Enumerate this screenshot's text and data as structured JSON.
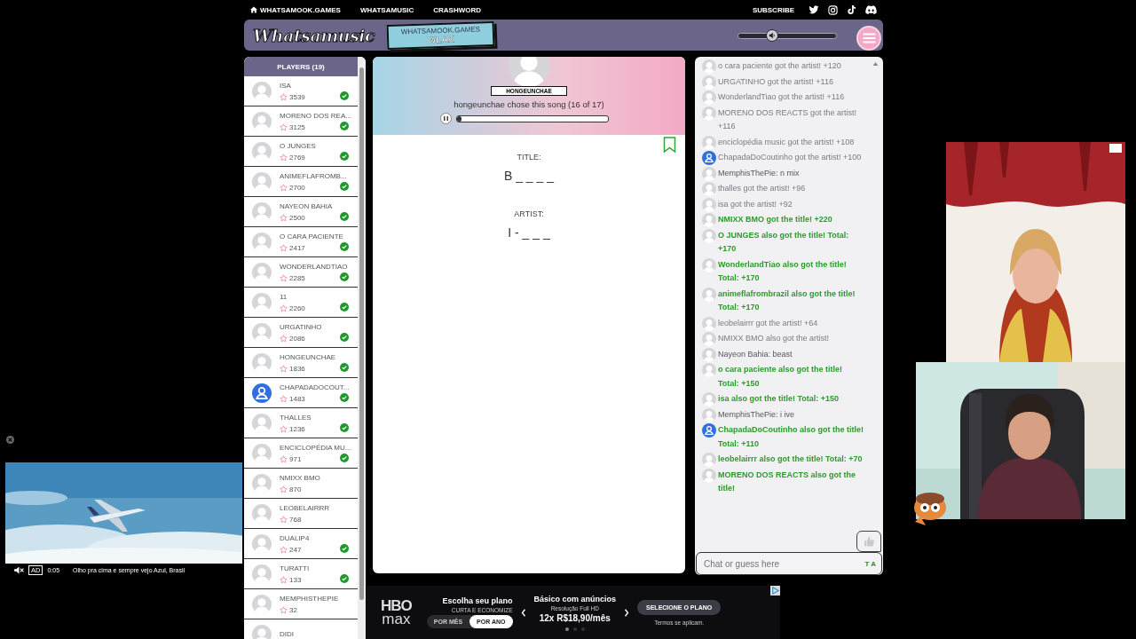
{
  "nav": {
    "links": [
      {
        "label": "WHATSAMOOK.GAMES",
        "kind": "home"
      },
      {
        "label": "WHATSAMUSIC",
        "kind": "plain"
      },
      {
        "label": "CRASHWORD",
        "kind": "plain"
      }
    ],
    "subscribe": "SUBSCRIBE"
  },
  "header": {
    "logo": "Whatsamusic",
    "tag_site": "WHATSAMOOK.GAMES",
    "tag_code": "WLAK",
    "volume": {
      "level": 0.35
    }
  },
  "players": {
    "title": "PLAYERS (19)",
    "items": [
      {
        "name": "ISA",
        "score": "3539",
        "guessed": true,
        "custom_avatar": false
      },
      {
        "name": "MORENO DOS REA...",
        "score": "3125",
        "guessed": true,
        "custom_avatar": false
      },
      {
        "name": "O JUNGES",
        "score": "2769",
        "guessed": true,
        "custom_avatar": false
      },
      {
        "name": "ANIMEFLAFROMB...",
        "score": "2700",
        "guessed": true,
        "custom_avatar": false
      },
      {
        "name": "NAYEON BAHIA",
        "score": "2500",
        "guessed": true,
        "custom_avatar": false
      },
      {
        "name": "O CARA PACIENTE",
        "score": "2417",
        "guessed": true,
        "custom_avatar": false
      },
      {
        "name": "WONDERLANDTIAO",
        "score": "2285",
        "guessed": true,
        "custom_avatar": false
      },
      {
        "name": "11",
        "score": "2260",
        "guessed": true,
        "custom_avatar": false
      },
      {
        "name": "URGATINHO",
        "score": "2086",
        "guessed": true,
        "custom_avatar": false
      },
      {
        "name": "HONGEUNCHAE",
        "score": "1836",
        "guessed": true,
        "custom_avatar": false
      },
      {
        "name": "CHAPADADOCOUT...",
        "score": "1483",
        "guessed": true,
        "custom_avatar": true
      },
      {
        "name": "THALLES",
        "score": "1236",
        "guessed": true,
        "custom_avatar": false
      },
      {
        "name": "ENCICLOPÉDIA MU...",
        "score": "971",
        "guessed": true,
        "custom_avatar": false
      },
      {
        "name": "NMIXX BMO",
        "score": "870",
        "guessed": false,
        "custom_avatar": false
      },
      {
        "name": "LEOBELAIRRR",
        "score": "768",
        "guessed": false,
        "custom_avatar": false
      },
      {
        "name": "DUALIP4",
        "score": "247",
        "guessed": true,
        "custom_avatar": false
      },
      {
        "name": "TURATTI",
        "score": "133",
        "guessed": true,
        "custom_avatar": false
      },
      {
        "name": "MEMPHISTHEPIE",
        "score": "32",
        "guessed": false,
        "custom_avatar": false
      },
      {
        "name": "DIDI",
        "guessed": false,
        "custom_avatar": false
      }
    ]
  },
  "song": {
    "chooser": "HONGEUNCHAE",
    "caption": "hongeunchae chose this song (16 of 17)",
    "playing": true,
    "progress": {
      "level": 0.03
    },
    "title_label": "TITLE:",
    "title_hint": "B _ _ _ _",
    "artist_label": "ARTIST:",
    "artist_hint": "I - _ _ _"
  },
  "chat": {
    "messages": [
      {
        "text": "o cara paciente got the artist! +120",
        "kind": "artist",
        "custom_avatar": false
      },
      {
        "text": "URGATINHO got the artist! +116",
        "kind": "artist",
        "custom_avatar": false
      },
      {
        "text": "WonderlandTiao got the artist! +116",
        "kind": "artist",
        "custom_avatar": false
      },
      {
        "text": "MORENO DOS REACTS got the artist! +116",
        "kind": "artist",
        "custom_avatar": false
      },
      {
        "text": "enciclopédia music got the artist! +108",
        "kind": "artist",
        "custom_avatar": false
      },
      {
        "text": "ChapadaDoCoutinho got the artist! +100",
        "kind": "artist",
        "custom_avatar": true
      },
      {
        "text": "MemphisThePie: n mix",
        "kind": "chat",
        "custom_avatar": false
      },
      {
        "text": "thalles got the artist! +96",
        "kind": "artist",
        "custom_avatar": false
      },
      {
        "text": "isa got the artist! +92",
        "kind": "artist",
        "custom_avatar": false
      },
      {
        "text": "NMIXX BMO got the title! +220",
        "kind": "title",
        "custom_avatar": false
      },
      {
        "text": "O JUNGES also got the title! Total: +170",
        "kind": "title",
        "custom_avatar": false
      },
      {
        "text": "WonderlandTiao also got the title! Total: +170",
        "kind": "title",
        "custom_avatar": false
      },
      {
        "text": "animeflafrombrazil also got the title! Total: +170",
        "kind": "title",
        "custom_avatar": false
      },
      {
        "text": "leobelairrr got the artist! +64",
        "kind": "artist",
        "custom_avatar": false
      },
      {
        "text": "NMIXX BMO also got the artist!",
        "kind": "artist",
        "custom_avatar": false
      },
      {
        "text": "Nayeon Bahia: beast",
        "kind": "chat",
        "custom_avatar": false
      },
      {
        "text": "o cara paciente also got the title! Total: +150",
        "kind": "title",
        "custom_avatar": false
      },
      {
        "text": "isa also got the title! Total: +150",
        "kind": "title",
        "custom_avatar": false
      },
      {
        "text": "MemphisThePie: i ive",
        "kind": "chat",
        "custom_avatar": false
      },
      {
        "text": "ChapadaDoCoutinho also got the title! Total: +110",
        "kind": "title",
        "custom_avatar": true
      },
      {
        "text": "leobelairrr also got the title! Total: +70",
        "kind": "title",
        "custom_avatar": false
      },
      {
        "text": "MORENO DOS REACTS also got the title!",
        "kind": "title",
        "custom_avatar": false
      }
    ],
    "input": {
      "placeholder": "Chat or guess here",
      "tools": "T A"
    }
  },
  "video_ad": {
    "label": "AD",
    "time": "0:05",
    "caption": "Olho pra cima e sempre vejo Azul, Brasil",
    "muted": true
  },
  "bottom_ad": {
    "logo_top": "HBO",
    "logo_bottom": "max",
    "heading": "Escolha seu plano",
    "subheading": "CURTA E ECONOMIZE",
    "options": [
      {
        "label": "POR MÊS",
        "selected": false
      },
      {
        "label": "POR ANO",
        "selected": true
      }
    ],
    "plan": "Básico com anúncios",
    "plan_note": "Resolução Full HD",
    "price": "12x R$18,90/mês",
    "cta": "SELECIONE O PLANO",
    "terms": "Termos se aplicam.",
    "dots": [
      {
        "selected": true
      },
      {
        "selected": false
      },
      {
        "selected": false
      }
    ]
  }
}
